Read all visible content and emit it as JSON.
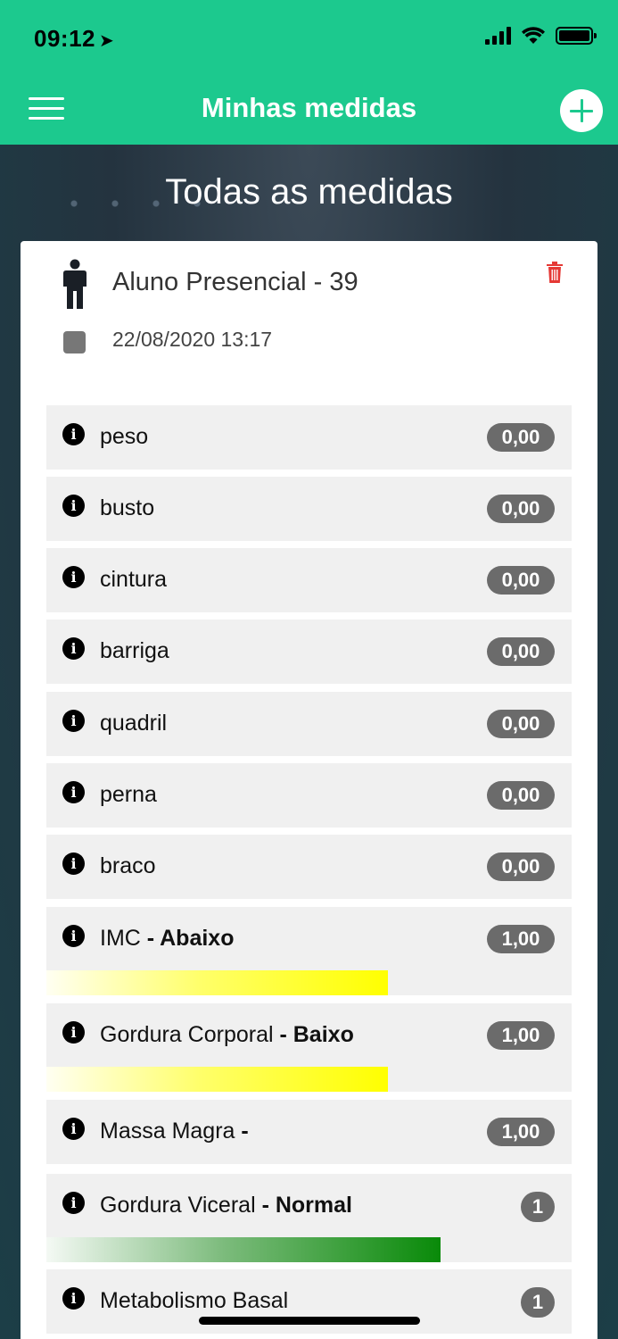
{
  "status": {
    "time": "09:12"
  },
  "header": {
    "title": "Minhas medidas"
  },
  "page": {
    "heading": "Todas as medidas"
  },
  "card": {
    "title": "Aluno Presencial - 39",
    "date": "22/08/2020 13:17",
    "rows": [
      {
        "label": "peso",
        "value": "0,00"
      },
      {
        "label": "busto",
        "value": "0,00"
      },
      {
        "label": "cintura",
        "value": "0,00"
      },
      {
        "label": "barriga",
        "value": "0,00"
      },
      {
        "label": "quadril",
        "value": "0,00"
      },
      {
        "label": "perna",
        "value": "0,00"
      },
      {
        "label": "braco",
        "value": "0,00"
      },
      {
        "label": "IMC",
        "status": "- Abaixo",
        "value": "1,00",
        "bar_color": "#ffff00",
        "bar_level": 0.65
      },
      {
        "label": "Gordura Corporal",
        "status": "- Baixo",
        "value": "1,00",
        "bar_color": "#ffff00",
        "bar_level": 0.65
      },
      {
        "label": "Massa Magra",
        "status": "-",
        "value": "1,00"
      },
      {
        "label": "Gordura Viceral",
        "status": "- Normal",
        "value": "1",
        "bar_color": "#098a09",
        "bar_level": 0.75
      },
      {
        "label": "Metabolismo Basal",
        "value": "1"
      }
    ]
  },
  "colors": {
    "accent": "#1cc98e",
    "delete": "#e53935",
    "pill": "#6b6b6b"
  }
}
